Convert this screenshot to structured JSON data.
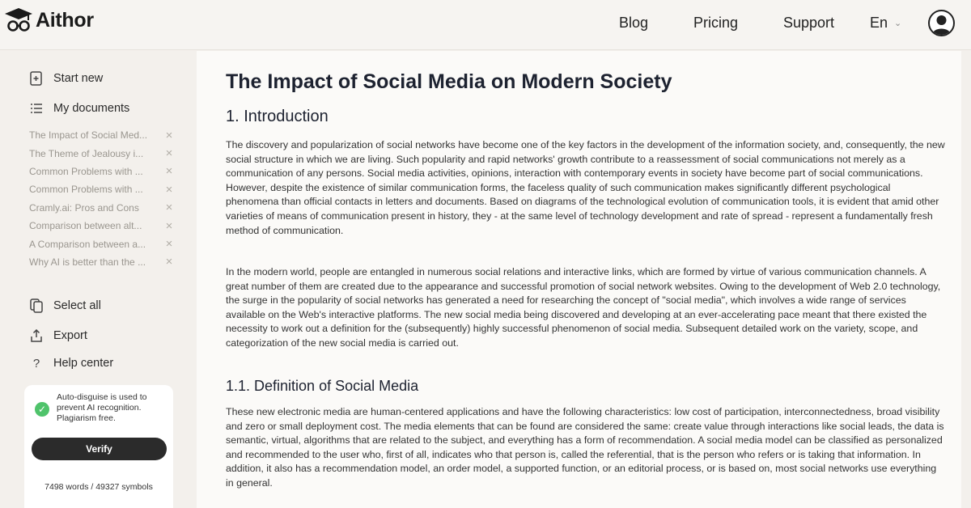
{
  "brand": {
    "name": "Aithor"
  },
  "nav": {
    "blog": "Blog",
    "pricing": "Pricing",
    "support": "Support",
    "language": "En"
  },
  "sidebar": {
    "start_new": "Start new",
    "my_documents": "My documents",
    "documents": [
      "The Impact of Social Med...",
      "The Theme of Jealousy i...",
      "Common Problems with ...",
      "Common Problems with ...",
      "Cramly.ai: Pros and Cons",
      "Comparison between alt...",
      "A Comparison between a...",
      "Why AI is better than the ..."
    ],
    "select_all": "Select all",
    "export": "Export",
    "help_center": "Help center",
    "notice": "Auto-disguise is used to prevent AI recognition. Plagiarism free.",
    "verify": "Verify",
    "counter": "7498 words / 49327 symbols"
  },
  "document": {
    "title": "The Impact of Social Media on Modern Society",
    "section1": "1. Introduction",
    "para1": "The discovery and popularization of social networks have become one of the key factors in the development of the information society, and, consequently, the new social structure in which we are living. Such popularity and rapid networks' growth contribute to a reassessment of social communications not merely as a communication of any persons. Social media activities, opinions, interaction with contemporary events in society have become part of social communications. However, despite the existence of similar communication forms, the faceless quality of such communication makes significantly different psychological phenomena than official contacts in letters and documents. Based on diagrams of the technological evolution of communication tools, it is evident that amid other varieties of means of communication present in history, they - at the same level of technology development and rate of spread - represent a fundamentally fresh method of communication.",
    "para2": "In the modern world, people are entangled in numerous social relations and interactive links, which are formed by virtue of various communication channels. A great number of them are created due to the appearance and successful promotion of social network websites. Owing to the development of Web 2.0 technology, the surge in the popularity of social networks has generated a need for researching the concept of \"social media\", which involves a wide range of services available on the Web's interactive platforms. The new social media being discovered and developing at an ever-accelerating pace meant that there existed the necessity to work out a definition for the (subsequently) highly successful phenomenon of social media. Subsequent detailed work on the variety, scope, and categorization of the new social media is carried out.",
    "section11": "1.1. Definition of Social Media",
    "para3": "These new electronic media are human-centered applications and have the following characteristics: low cost of participation, interconnectedness, broad visibility and zero or small deployment cost. The media elements that can be found are considered the same: create value through interactions like social leads, the data is semantic, virtual, algorithms that are related to the subject, and everything has a form of recommendation. A social media model can be classified as personalized and recommended to the user who, first of all, indicates who that person is, called the referential, that is the person who refers or is taking that information. In addition, it also has a recommendation model, an order model, a supported function, or an editorial process, or is based on, most social networks use everything in general."
  }
}
